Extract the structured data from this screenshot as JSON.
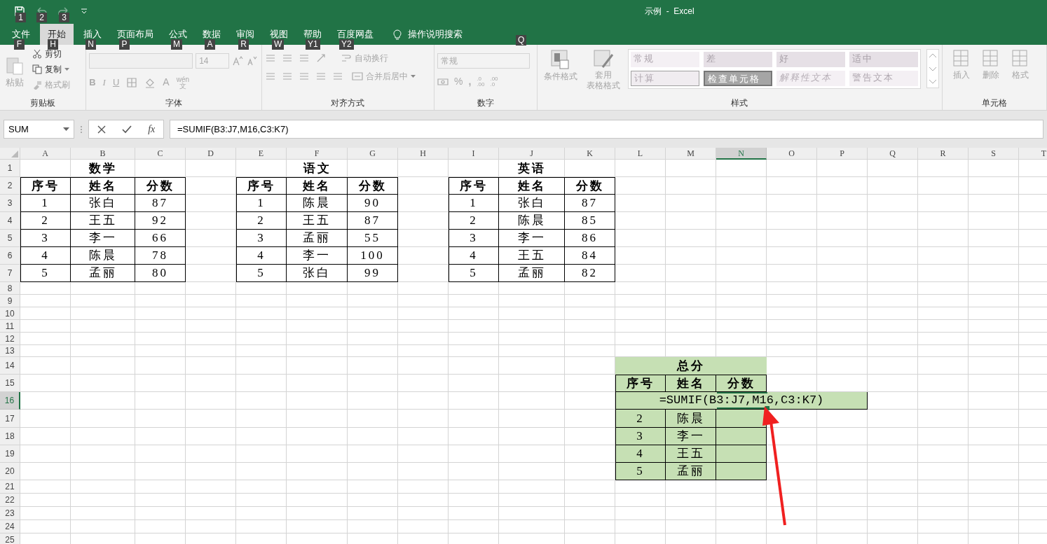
{
  "window": {
    "title": "示例  -  Excel"
  },
  "quick_access": [
    {
      "kind": "save",
      "keytip": "1"
    },
    {
      "kind": "undo",
      "keytip": "2"
    },
    {
      "kind": "redo",
      "keytip": "3"
    },
    {
      "kind": "customize"
    }
  ],
  "tabs": [
    {
      "label": "文件",
      "keytip": "F",
      "selected": false
    },
    {
      "label": "开始",
      "keytip": "H",
      "selected": true
    },
    {
      "label": "插入",
      "keytip": "N",
      "selected": false
    },
    {
      "label": "页面布局",
      "keytip": "P",
      "selected": false
    },
    {
      "label": "公式",
      "keytip": "M",
      "selected": false
    },
    {
      "label": "数据",
      "keytip": "A",
      "selected": false
    },
    {
      "label": "审阅",
      "keytip": "R",
      "selected": false
    },
    {
      "label": "视图",
      "keytip": "W",
      "selected": false
    },
    {
      "label": "帮助",
      "keytip": "Y1",
      "selected": false
    },
    {
      "label": "百度网盘",
      "keytip": "Y2",
      "selected": false
    }
  ],
  "tell_me": {
    "label": "操作说明搜索",
    "keytip": "Q"
  },
  "ribbon": {
    "clipboard": {
      "label": "剪贴板",
      "paste": "粘贴",
      "cut": "剪切",
      "copy": "复制",
      "format_painter": "格式刷"
    },
    "font": {
      "label": "字体",
      "size": "14",
      "bold": "B",
      "italic": "I",
      "underline": "U",
      "font_color": "A",
      "phonetic_top": "wén",
      "phonetic_bottom": "文"
    },
    "alignment": {
      "label": "对齐方式",
      "wrap_text": "自动换行",
      "merge_center": "合并后居中"
    },
    "number": {
      "label": "数字",
      "format": "常规",
      "percent": "%",
      "comma": ",",
      "increase_decimal": [
        ".0",
        ".00"
      ],
      "decrease_decimal": [
        ".00",
        ".0"
      ]
    },
    "styles": {
      "label": "样式",
      "conditional": "条件格式",
      "table_format": [
        "套用",
        "表格格式"
      ],
      "gallery": [
        {
          "label": "常规",
          "kind": "normal"
        },
        {
          "label": "差",
          "kind": "bad"
        },
        {
          "label": "好",
          "kind": "good"
        },
        {
          "label": "适中",
          "kind": "neutral"
        },
        {
          "label": "计算",
          "kind": "calc"
        },
        {
          "label": "检查单元格",
          "kind": "check"
        },
        {
          "label": "解释性文本",
          "kind": "explain"
        },
        {
          "label": "警告文本",
          "kind": "warn"
        }
      ]
    },
    "cells": {
      "label": "单元格",
      "insert": "插入",
      "delete": "删除",
      "format": "格式"
    }
  },
  "formula_bar": {
    "name_box": "SUM",
    "fx": "fx",
    "formula": "=SUMIF(B3:J7,M16,C3:K7)"
  },
  "column_headers": [
    {
      "label": "A",
      "selected": false
    },
    {
      "label": "B",
      "selected": false
    },
    {
      "label": "C",
      "selected": false
    },
    {
      "label": "D",
      "selected": false
    },
    {
      "label": "E",
      "selected": false
    },
    {
      "label": "F",
      "selected": false
    },
    {
      "label": "G",
      "selected": false
    },
    {
      "label": "H",
      "selected": false
    },
    {
      "label": "I",
      "selected": false
    },
    {
      "label": "J",
      "selected": false
    },
    {
      "label": "K",
      "selected": false
    },
    {
      "label": "L",
      "selected": false
    },
    {
      "label": "M",
      "selected": false
    },
    {
      "label": "N",
      "selected": true
    },
    {
      "label": "O",
      "selected": false
    },
    {
      "label": "P",
      "selected": false
    },
    {
      "label": "Q",
      "selected": false
    },
    {
      "label": "R",
      "selected": false
    },
    {
      "label": "S",
      "selected": false
    },
    {
      "label": "T",
      "selected": false
    }
  ],
  "row_headers": [
    {
      "label": "1",
      "selected": false
    },
    {
      "label": "2",
      "selected": false
    },
    {
      "label": "3",
      "selected": false
    },
    {
      "label": "4",
      "selected": false
    },
    {
      "label": "5",
      "selected": false
    },
    {
      "label": "6",
      "selected": false
    },
    {
      "label": "7",
      "selected": false
    },
    {
      "label": "8",
      "selected": false
    },
    {
      "label": "9",
      "selected": false
    },
    {
      "label": "10",
      "selected": false
    },
    {
      "label": "11",
      "selected": false
    },
    {
      "label": "12",
      "selected": false
    },
    {
      "label": "13",
      "selected": false
    },
    {
      "label": "14",
      "selected": false
    },
    {
      "label": "15",
      "selected": false
    },
    {
      "label": "16",
      "selected": true
    },
    {
      "label": "17",
      "selected": false
    },
    {
      "label": "18",
      "selected": false
    },
    {
      "label": "19",
      "selected": false
    },
    {
      "label": "20",
      "selected": false
    },
    {
      "label": "21",
      "selected": false
    },
    {
      "label": "22",
      "selected": false
    },
    {
      "label": "23",
      "selected": false
    },
    {
      "label": "24",
      "selected": false
    },
    {
      "label": "25",
      "selected": false
    }
  ],
  "tables": [
    {
      "title": "数学",
      "columns": [
        "序号",
        "姓名",
        "分数"
      ],
      "rows": [
        [
          "1",
          "张白",
          "87"
        ],
        [
          "2",
          "王五",
          "92"
        ],
        [
          "3",
          "李一",
          "66"
        ],
        [
          "4",
          "陈晨",
          "78"
        ],
        [
          "5",
          "孟丽",
          "80"
        ]
      ]
    },
    {
      "title": "语文",
      "columns": [
        "序号",
        "姓名",
        "分数"
      ],
      "rows": [
        [
          "1",
          "陈晨",
          "90"
        ],
        [
          "2",
          "王五",
          "87"
        ],
        [
          "3",
          "孟丽",
          "55"
        ],
        [
          "4",
          "李一",
          "100"
        ],
        [
          "5",
          "张白",
          "99"
        ]
      ]
    },
    {
      "title": "英语",
      "columns": [
        "序号",
        "姓名",
        "分数"
      ],
      "rows": [
        [
          "1",
          "张白",
          "87"
        ],
        [
          "2",
          "陈晨",
          "85"
        ],
        [
          "3",
          "李一",
          "86"
        ],
        [
          "4",
          "王五",
          "84"
        ],
        [
          "5",
          "孟丽",
          "82"
        ]
      ]
    }
  ],
  "summary_table": {
    "title": "总分",
    "columns": [
      "序号",
      "姓名",
      "分数"
    ],
    "editing_formula": "=SUMIF(B3:J7,M16,C3:K7)",
    "rows": [
      [
        "2",
        "陈晨"
      ],
      [
        "3",
        "李一"
      ],
      [
        "4",
        "王五"
      ],
      [
        "5",
        "孟丽"
      ]
    ]
  }
}
